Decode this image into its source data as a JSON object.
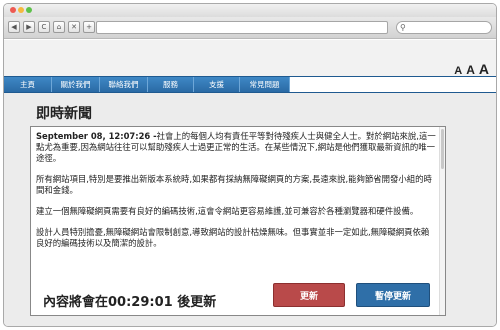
{
  "browser": {
    "back_glyph": "◀",
    "forward_glyph": "▶",
    "reload_glyph": "C",
    "home_glyph": "⌂",
    "close_glyph": "✕",
    "newtab_glyph": "+",
    "search_glyph": "⚲"
  },
  "font_size": {
    "small": "A",
    "medium": "A",
    "large": "A"
  },
  "nav": {
    "items": [
      {
        "label": "主頁"
      },
      {
        "label": "關於我們"
      },
      {
        "label": "聯絡我們"
      },
      {
        "label": "服務"
      },
      {
        "label": "支援"
      },
      {
        "label": "常見問題"
      }
    ]
  },
  "news": {
    "title": "即時新聞",
    "timestamp": "September 08, 12:07:26 -",
    "lead": "社會上的每個人均有責任平等對待殘疾人士與健全人士。對於網站來說,這一點尤為重要,因為網站往往可以幫助殘疾人士過更正常的生活。在某些情況下,網站是他們獲取最新資訊的唯一途徑。",
    "paragraphs": [
      "所有網站項目,特別是要推出新版本系統時,如果都有採納無障礙網頁的方案,長遠來說,能夠節省開發小組的時間和金錢。",
      "建立一個無障礙網頁需要有良好的編碼技術,這會令網站更容易維護,並可兼容於各種瀏覽器和硬件設備。",
      "設計人員特別擔憂,無障礙網站會限制創意,導致網站的設計枯燥無味。但事實並非一定如此,無障礙網頁依賴良好的編碼技術以及簡潔的設計。"
    ],
    "countdown_text": "內容將會在00:29:01 後更新",
    "update_label": "更新",
    "pause_label": "暫停更新"
  },
  "colors": {
    "nav_blue": "#2f78b6",
    "update_red": "#b94a4a",
    "pause_blue": "#2f6fa8"
  }
}
